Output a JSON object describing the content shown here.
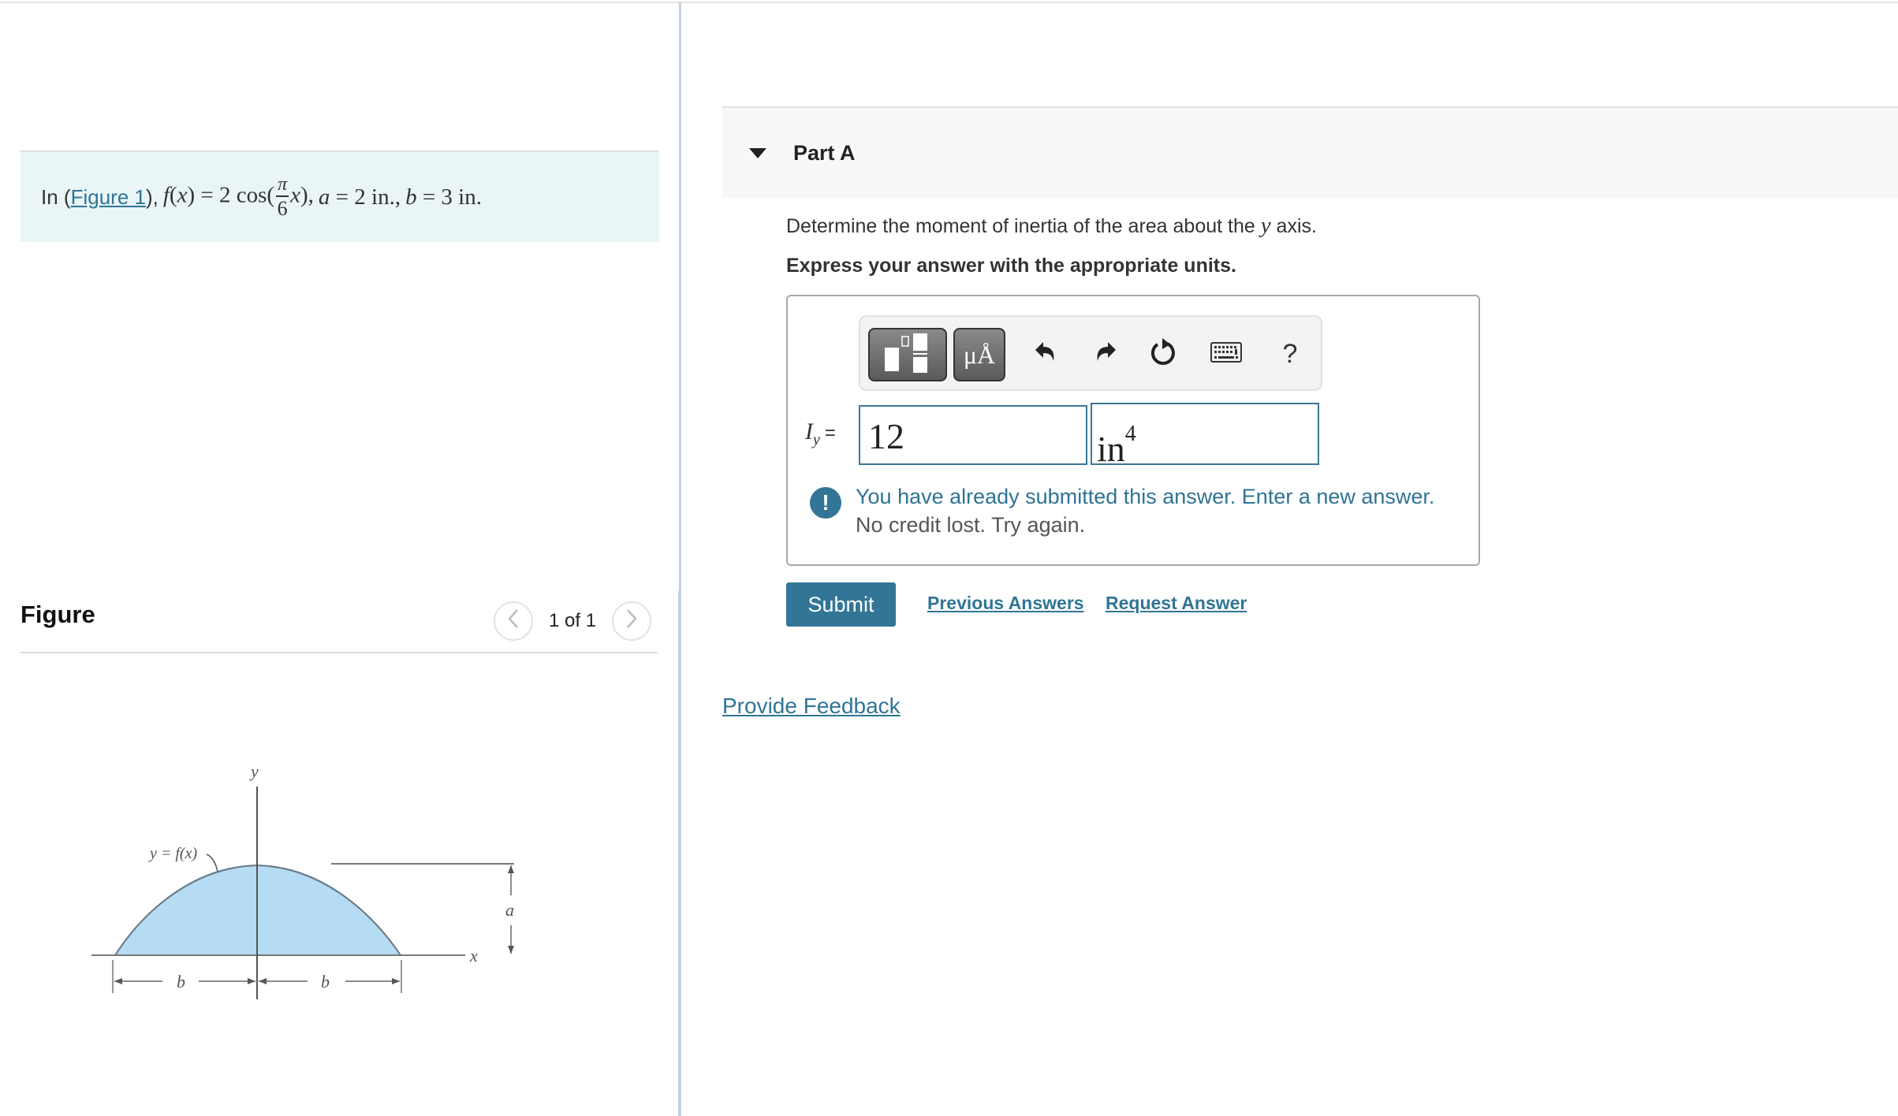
{
  "intro": {
    "prefix": "In (",
    "figure_link": "Figure 1",
    "suffix_after_link": "),",
    "function_name": "f",
    "function_arg": "x",
    "equals": "=",
    "coefficient": "2",
    "trig": "cos(",
    "frac_numerator": "π",
    "frac_denominator": "6",
    "trig_arg": "x",
    "trig_close": "),",
    "param_a_name": "a",
    "param_a_value": " = 2 in.,",
    "param_b_name": "b",
    "param_b_value": " = 3 in."
  },
  "figure": {
    "title": "Figure",
    "pager_text": "1 of 1",
    "prev_icon": "chevron-left-icon",
    "next_icon": "chevron-right-icon",
    "labels": {
      "y_axis": "y",
      "x_axis": "x",
      "curve": "y = f(x)",
      "height": "a",
      "half_width_left": "b",
      "half_width_right": "b"
    },
    "fill_color": "#b5dcf3"
  },
  "part": {
    "title": "Part A",
    "question_prefix": "Determine the moment of inertia of the area about the ",
    "question_var": "y",
    "question_suffix": " axis.",
    "instruction": "Express your answer with the appropriate units."
  },
  "toolbar": {
    "templates_icon": "templates-icon",
    "units_label": "μÅ",
    "undo_icon": "undo-icon",
    "redo_icon": "redo-icon",
    "reset_icon": "reset-icon",
    "keyboard_icon": "keyboard-icon",
    "help_label": "?"
  },
  "answer": {
    "lhs_symbol": "I",
    "lhs_subscript": "y",
    "lhs_equals": "=",
    "value": "12",
    "unit_base": "in",
    "unit_exponent": "4"
  },
  "feedback_message": {
    "icon": "exclamation-icon",
    "icon_glyph": "!",
    "line1": "You have already submitted this answer. Enter a new answer.",
    "line2": "No credit lost. Try again."
  },
  "actions": {
    "submit": "Submit",
    "previous_answers": "Previous Answers",
    "request_answer": "Request Answer",
    "provide_feedback": "Provide Feedback"
  },
  "colors": {
    "accent": "#337596",
    "link": "#2f7597",
    "intro_bg": "#eaf5f8",
    "part_header_bg": "#f8f8f8"
  }
}
